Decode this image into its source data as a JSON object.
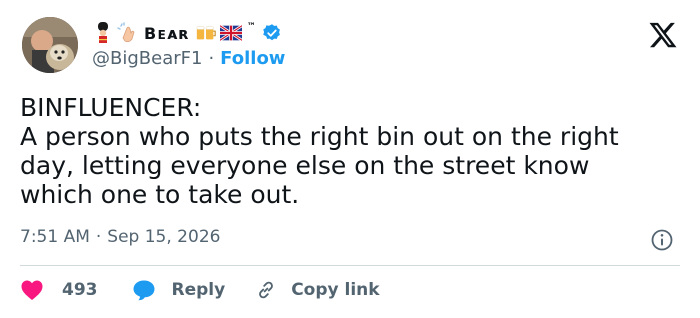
{
  "author": {
    "display_name": "Bᴇᴀʀ",
    "tm": "™",
    "handle": "@BigBearF1",
    "separator": "·",
    "follow_label": "Follow"
  },
  "tweet": {
    "text": "BINFLUENCER:\nA person who puts the right bin out on the right day, letting everyone else on the street know which one to take out.",
    "time": "7:51 AM",
    "date_separator": "·",
    "date": "Sep 15, 2026"
  },
  "actions": {
    "like_count": "493",
    "reply_label": "Reply",
    "copy_link_label": "Copy link"
  },
  "colors": {
    "accent": "#1d9bf0",
    "like_heart": "#f91880",
    "muted_text": "#536471",
    "text": "#0f1419",
    "divider": "#cfd9de"
  },
  "icons": [
    "avatar-photo",
    "guard-icon",
    "clapping-hands-icon",
    "beer-mugs-icon",
    "uk-flag-icon",
    "verified-badge-icon",
    "x-logo-icon",
    "info-icon",
    "heart-icon",
    "reply-bubble-icon",
    "link-icon"
  ]
}
